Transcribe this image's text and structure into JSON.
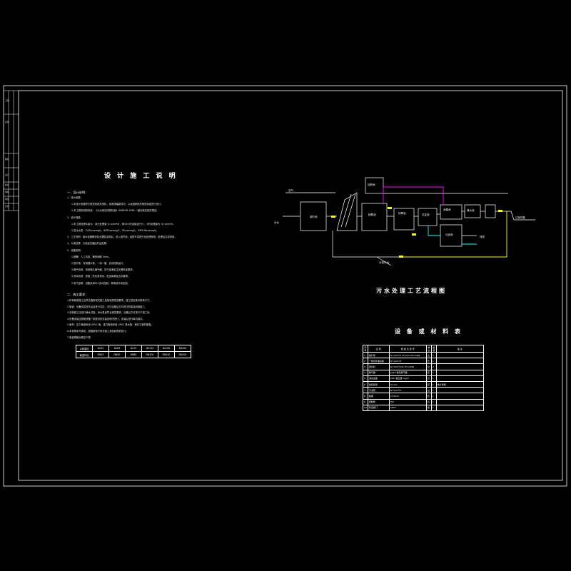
{
  "drawing": {
    "notes_title": "设 计 施 工 说 明",
    "diagram_title": "污水处理工艺流程图",
    "table_title": "设 备 或 材 料 表"
  },
  "title_block": {
    "rows": [
      "工程",
      "名称",
      "图名",
      "设计",
      "校对",
      "审核",
      "审定",
      "比例",
      "日期",
      "图号"
    ]
  },
  "notes": {
    "section1": "一、设计说明：",
    "lines1": [
      "1、设计依据：",
      "1.本设计依据甲方提供的相关资料，及现场踏勘情况，以及国家相关规范标准进行设计。",
      "2.本工程采用的标准：《污水综合排放标准》GB8978-1996 一级标准及相关规范。",
      "2、设计规模：",
      "1.本工程处理水量为：设计处理量 Q=xxm³/d，按24小时连续运行计，小时处理量为 Q=xxm³/h。",
      "2.进水水质：COD≤xxmg/L，BOD≤xxmg/L，SS≤xxmg/L，NH3-N≤xxmg/L。",
      "3、工艺说明：废水经格栅去除大颗粒杂物后，进入调节池，经提升泵提升至处理系统，处理后达标排放。",
      "4、污泥处理：污泥经浓缩后外运处置。",
      "5、设备说明：",
      "1.格栅：人工清渣，栅条间隙 5mm。",
      "2.提升泵：采用潜水泵，一用一备，自动控制运行。",
      "3.曝气系统：采用微孔曝气器，供气量满足生化需氧量要求。",
      "4.消毒系统：采用二氧化氯消毒，投加量满足出水要求。",
      "5.电气控制：设备采用PLC自动控制，现场设手动控制。"
    ],
    "section2": "二、施工要求：",
    "lines2": [
      "1.所有管道施工应符合国家相关施工及验收规范的要求，施工前应核对现场尺寸。",
      "2.管道、设备安装完毕后应进行试压，试压合格后方可进行防腐及回填施工。",
      "3.池体施工应进行满水试验，渗水量应符合规范要求，合格后方可进行下道工序。",
      "4.设备安装应按照设备厂家提供的安装说明书进行，安装后进行单机调试。",
      "5.管材：压力管道采用 UPVC 管，重力管道采用 UPVC 排水管，管件与管材配套。",
      "6.本说明未尽事宜，按国家现行有关施工及验收规范执行。",
      "7.管道规格对照见下表："
    ],
    "pipe_table": {
      "header": [
        "公称直径",
        "De32",
        "De63",
        "De75",
        "De110",
        "De160",
        "De200"
      ],
      "row": [
        "管道外径",
        "DN25",
        "DN50",
        "DN65",
        "DN100",
        "DN150",
        "DN200"
      ]
    }
  },
  "diagram": {
    "labels": {
      "inlet": "污水",
      "grille": "格栅",
      "pump": "提升泵",
      "tank1": "调节池",
      "tank2": "缺氧池",
      "tank3": "好氧池",
      "tank4": "沉淀池",
      "tank5": "消毒池",
      "tank6": "清水池",
      "sludge": "污泥池",
      "dosing": "加药间",
      "blower": "鼓风机",
      "outlet": "达标排放",
      "sludge_out": "污泥外运",
      "air": "空气",
      "return": "回流",
      "drain": "排放"
    }
  },
  "equipment": {
    "headers": [
      "序号",
      "名 称",
      "规 格 及 型 号",
      "单位",
      "数量",
      "备 注"
    ],
    "rows": [
      [
        "1",
        "提升泵",
        "Q=xxm³/h H=xxm N=xxkW",
        "台",
        "2",
        ""
      ],
      [
        "2",
        "一体化处理设备",
        "Q=xxm³/d",
        "套",
        "1",
        ""
      ],
      [
        "3",
        "鼓风机",
        "Q=xxm³/min P=xxkPa",
        "台",
        "2",
        ""
      ],
      [
        "4",
        "曝气器",
        "φ215 微孔曝气器",
        "套",
        "1",
        ""
      ],
      [
        "5",
        "消毒设备",
        "ClO₂ 发生器 xxg/h",
        "台",
        "1",
        ""
      ],
      [
        "6",
        "加药装置",
        "V=xxL",
        "套",
        "1",
        "含计量泵"
      ],
      [
        "7",
        "污泥泵",
        "Q=xxm³/h",
        "台",
        "1",
        ""
      ],
      [
        "8",
        "格栅",
        "b=5mm",
        "套",
        "1",
        ""
      ],
      [
        "9",
        "控制柜",
        "PLC",
        "台",
        "1",
        ""
      ],
      [
        "10",
        "管道阀门",
        "UPVC",
        "批",
        "1",
        ""
      ]
    ]
  },
  "colors": {
    "line": "#ffffff",
    "pipe_yellow": "#ffff00",
    "pipe_magenta": "#ff00ff",
    "pipe_cyan": "#00ffff",
    "frame": "#ffffff"
  }
}
